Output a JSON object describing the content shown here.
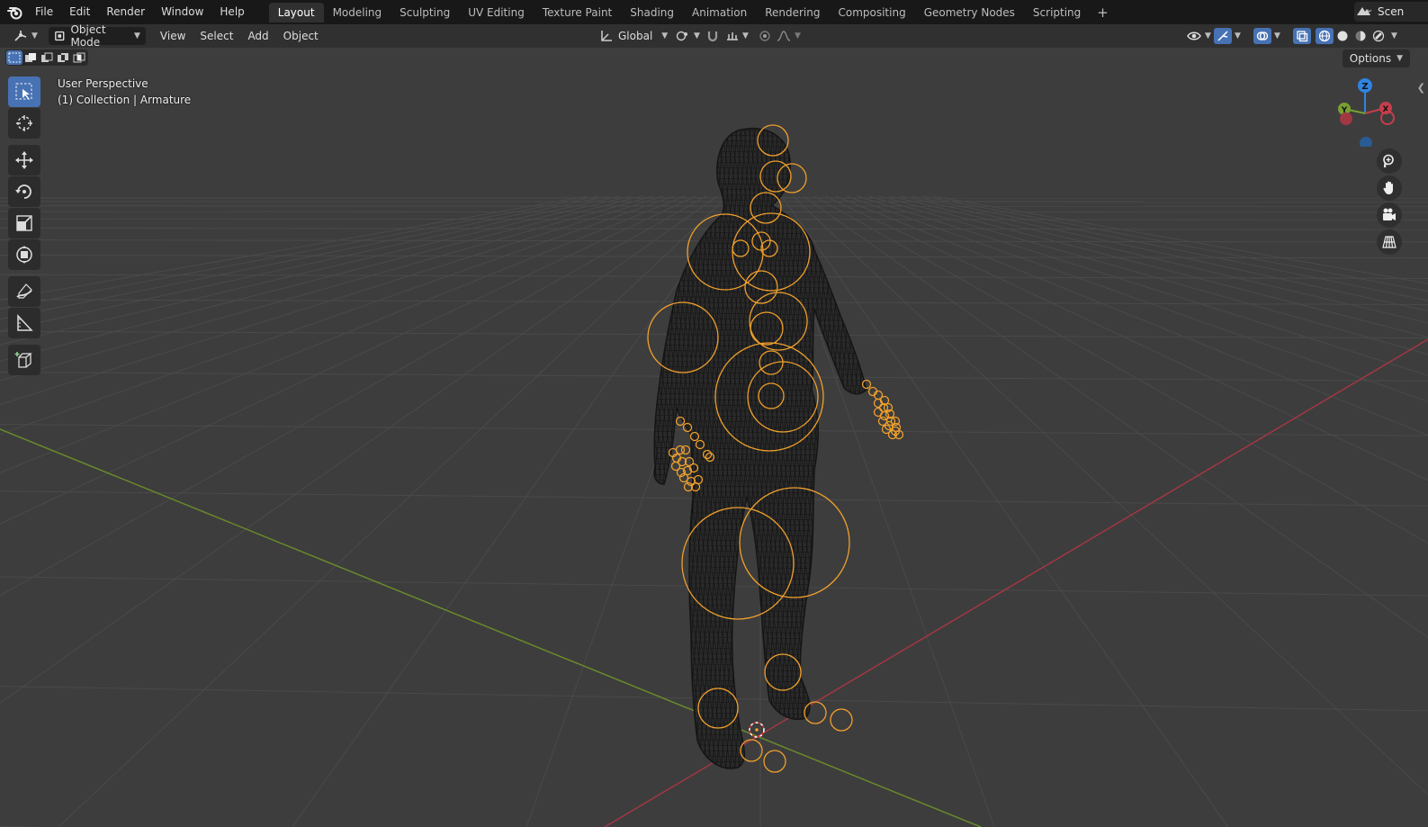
{
  "app": {
    "logo_icon": "blender-logo-icon"
  },
  "topbar": {
    "menus": [
      "File",
      "Edit",
      "Render",
      "Window",
      "Help"
    ],
    "workspaces": [
      "Layout",
      "Modeling",
      "Sculpting",
      "UV Editing",
      "Texture Paint",
      "Shading",
      "Animation",
      "Rendering",
      "Compositing",
      "Geometry Nodes",
      "Scripting"
    ],
    "active_workspace": "Layout",
    "add_workspace": "+",
    "scene_label": "Scen"
  },
  "header": {
    "mode": "Object Mode",
    "menus": [
      "View",
      "Select",
      "Add",
      "Object"
    ],
    "orientation": "Global"
  },
  "viewport": {
    "perspective": "User Perspective",
    "collection": "(1) Collection | Armature",
    "options": "Options",
    "gizmo": {
      "z_label": "Z",
      "x_label": "X",
      "y_label": "Y"
    }
  },
  "colors": {
    "accent": "#4772b3",
    "selection": "#f0a02c",
    "x_axis": "#c63e4c",
    "y_axis": "#77a132",
    "z_axis": "#2f84e0"
  }
}
